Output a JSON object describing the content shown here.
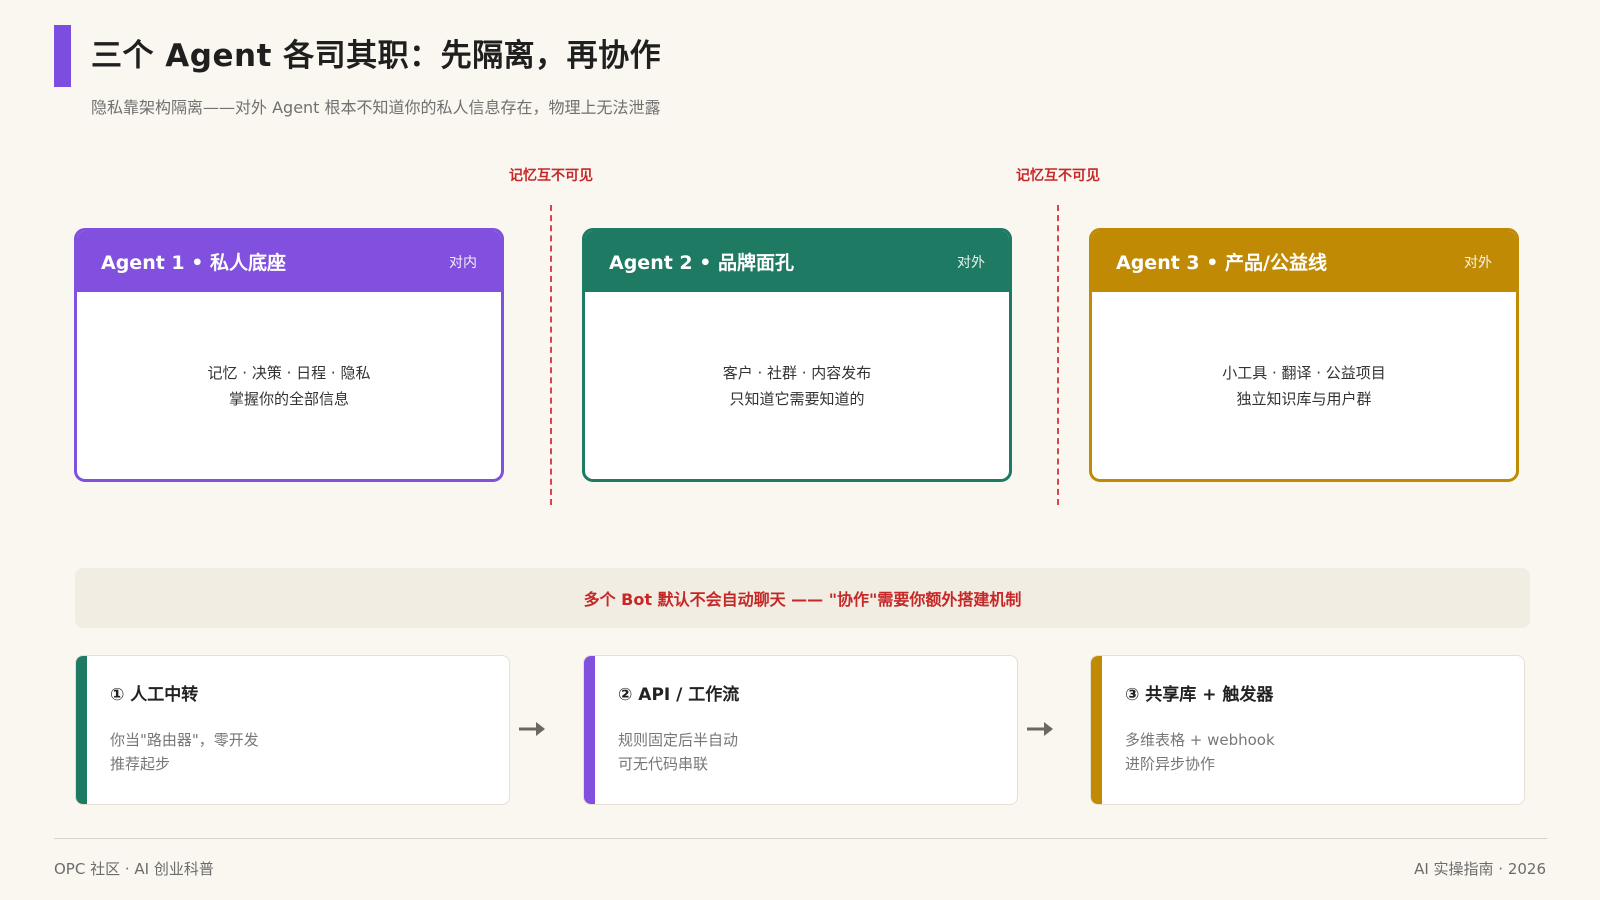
{
  "header": {
    "title": "三个 Agent 各司其职：先隔离，再协作",
    "subtitle": "隐私靠架构隔离——对外 Agent 根本不知道你的私人信息存在，物理上无法泄露"
  },
  "separators": [
    {
      "label": "记忆互不可见"
    },
    {
      "label": "记忆互不可见"
    }
  ],
  "agents": [
    {
      "name": "Agent 1 • 私人底座",
      "tag": "对内",
      "line1": "记忆 · 决策 · 日程 · 隐私",
      "line2": "掌握你的全部信息",
      "color": "#8150de"
    },
    {
      "name": "Agent 2 • 品牌面孔",
      "tag": "对外",
      "line1": "客户 · 社群 · 内容发布",
      "line2": "只知道它需要知道的",
      "color": "#1e7a62"
    },
    {
      "name": "Agent 3 • 产品/公益线",
      "tag": "对外",
      "line1": "小工具 · 翻译 · 公益项目",
      "line2": "独立知识库与用户群",
      "color": "#c08a05"
    }
  ],
  "banner": {
    "text": "多个 Bot 默认不会自动聊天 —— \"协作\"需要你额外搭建机制"
  },
  "steps": [
    {
      "title": "① 人工中转",
      "line1": "你当\"路由器\"，零开发",
      "line2": "推荐起步",
      "color": "#1e7a62"
    },
    {
      "title": "② API / 工作流",
      "line1": "规则固定后半自动",
      "line2": "可无代码串联",
      "color": "#8150de"
    },
    {
      "title": "③ 共享库 + 触发器",
      "line1": "多维表格 + webhook",
      "line2": "进阶异步协作",
      "color": "#c08a05"
    }
  ],
  "footer": {
    "left": "OPC 社区 · AI 创业科普",
    "right": "AI 实操指南 · 2026"
  }
}
